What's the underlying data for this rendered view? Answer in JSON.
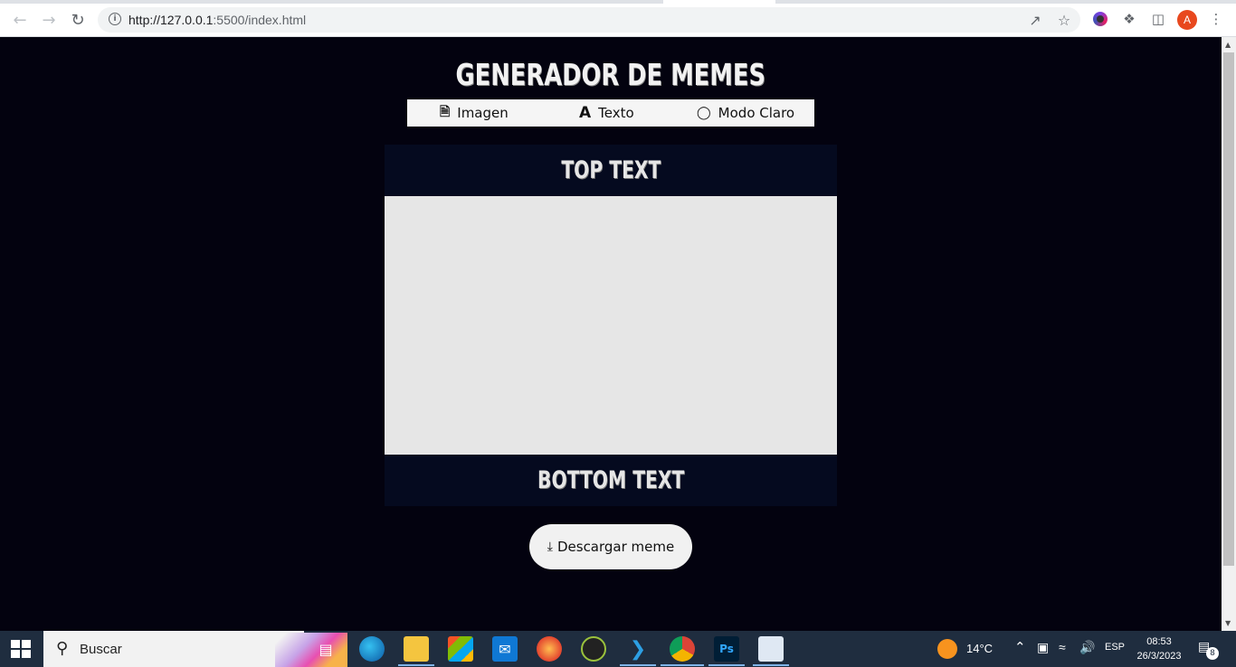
{
  "browser": {
    "url_host": "http://127.0.0.1",
    "url_path": ":5500/index.html",
    "profile_initial": "A",
    "icons": {
      "back": "back-arrow-icon",
      "forward": "forward-arrow-icon",
      "reload": "reload-icon",
      "info": "info-icon",
      "share": "share-icon",
      "bookmark": "star-icon",
      "extension": "extension-icon",
      "puzzle": "puzzle-icon",
      "side_panel": "side-panel-icon",
      "menu": "kebab-menu-icon"
    }
  },
  "page": {
    "title": "GENERADOR DE MEMES",
    "menu": [
      {
        "icon": "file-image-icon",
        "label": "Imagen"
      },
      {
        "icon": "text-font-icon",
        "label": "Texto"
      },
      {
        "icon": "lightbulb-icon",
        "label": "Modo Claro"
      }
    ],
    "meme": {
      "top_text": "TOP TEXT",
      "bottom_text": "BOTTOM TEXT"
    },
    "download_label": "Descargar meme",
    "colors": {
      "background": "#03020f",
      "text_box": "#050a1f",
      "image_placeholder": "#e6e6e6"
    }
  },
  "taskbar": {
    "search_placeholder": "Buscar",
    "apps": [
      "task-view-icon",
      "edge-icon",
      "file-explorer-icon",
      "microsoft-store-icon",
      "mail-icon",
      "firefox-icon",
      "inkscape-icon",
      "vscode-icon",
      "chrome-icon",
      "photoshop-icon",
      "paint-icon"
    ],
    "weather": "14°C",
    "language": "ESP",
    "time": "08:53",
    "date": "26/3/2023",
    "notifications": "8"
  }
}
